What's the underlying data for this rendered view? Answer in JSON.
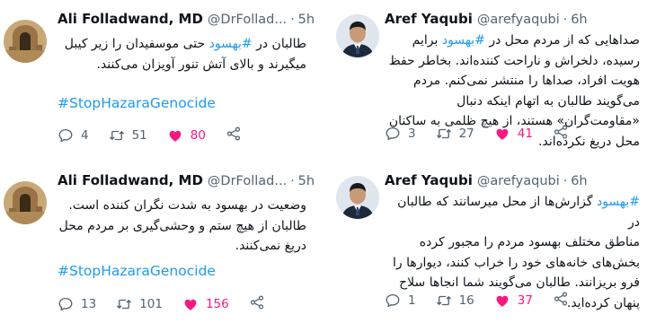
{
  "tweets": {
    "top_left": {
      "name": "Ali Folladwand, MD",
      "handle": "@DrFollad...",
      "dot": "·",
      "time": "5h",
      "line1_pre": "طالبان در ",
      "line1_tag": "#بهسود",
      "line1_post": " حتی موسفیدان را زیر کیبل",
      "line2": "میگیرند و بالای آتش تنور آویزان می‌کنند.",
      "hashtag": "#StopHazaraGenocide",
      "replies": "4",
      "retweets": "51",
      "likes": "80"
    },
    "bottom_left": {
      "name": "Ali Folladwand, MD",
      "handle": "@DrFollad...",
      "dot": "·",
      "time": "5h",
      "line1": "وضعیت در بهسود به شدت نگران کننده است.",
      "line2": "طالبان از هیچ ستم و وحشی‌گیری بر مردم محل",
      "line3": "دریغ نمی‌کنند.",
      "hashtag": "#StopHazaraGenocide",
      "replies": "13",
      "retweets": "101",
      "likes": "156"
    },
    "top_right": {
      "name": "Aref Yaqubi",
      "handle": "@arefyaqubi",
      "dot": "·",
      "time": "6h",
      "line1_pre": "صداهایی که از مردم محل در ",
      "line1_tag": "#بهسود",
      "line1_post": " برایم",
      "line2": "رسیده، دلخراش و ناراحت کننده‌اند. بخاطر حفظ",
      "line3": "هویت افراد، صداها را منتشر نمی‌کنم. مردم",
      "line4": "می‌گویند طالبان به اتهام اینکه دنبال",
      "line5": "«مقاومت‌گران» هستند، از هیچ ظلمی به ساکنان",
      "line6": "محل دریغ نکرده‌اند.",
      "replies": "3",
      "retweets": "27",
      "likes": "41"
    },
    "bottom_right": {
      "name": "Aref Yaqubi",
      "handle": "@arefyaqubi",
      "dot": "·",
      "time": "6h",
      "line1_tag": "#بهسود",
      "line1_post": " گزارش‌ها از محل میرسانند که طالبان در",
      "line2": "مناطق مختلف بهسود مردم را مجبور کرده",
      "line3": "بخش‌های خانه‌های خود را خراب کنند، دیوارها را",
      "line4": "فرو بریزانند. طالبان می‌گویند شما انجاها سلاح",
      "line5": "پنهان کرده‌اید.",
      "replies": "1",
      "retweets": "16",
      "likes": "37"
    }
  },
  "icons": {
    "reply": "reply-icon",
    "retweet": "retweet-icon",
    "like": "heart-icon",
    "share": "share-icon"
  },
  "colors": {
    "link": "#1d9bf0",
    "like": "#f91880",
    "muted": "#536471",
    "text": "#0f1419"
  }
}
